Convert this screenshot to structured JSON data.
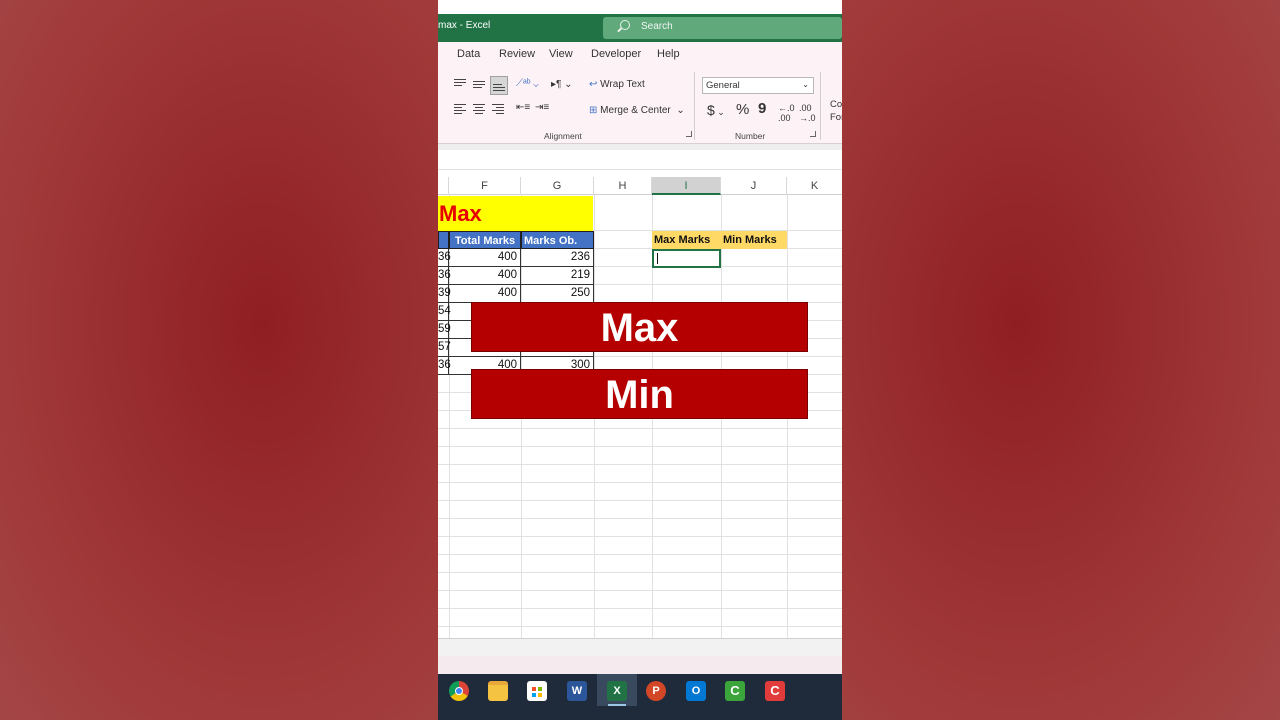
{
  "window": {
    "title": "max  -  Excel",
    "search_placeholder": "Search"
  },
  "tabs": [
    "Data",
    "Review",
    "View",
    "Developer",
    "Help"
  ],
  "ribbon": {
    "wrap_text": "Wrap Text",
    "merge_center": "Merge & Center",
    "number_format": "General",
    "currency": "$",
    "percent": "%",
    "comma": "9",
    "alignment_label": "Alignment",
    "number_label": "Number",
    "cond_fmt_1": "Co",
    "cond_fmt_2": "For"
  },
  "columns": [
    "F",
    "G",
    "H",
    "I",
    "J",
    "K"
  ],
  "sheet": {
    "title": "Max",
    "headers": {
      "total": "Total Marks",
      "obtained": "Marks Ob.",
      "max": "Max Marks",
      "min": "Min Marks"
    },
    "row_prefixes": [
      "36",
      "36",
      "39",
      "54",
      "59",
      "57",
      "36"
    ],
    "total_marks": [
      "400",
      "400",
      "400",
      "",
      "",
      "",
      "400"
    ],
    "marks_obtained": [
      "236",
      "219",
      "250",
      "",
      "",
      "",
      "300"
    ]
  },
  "banners": {
    "max": "Max",
    "min": "Min"
  },
  "taskbar": [
    "chrome-icon",
    "file-explorer-icon",
    "store-icon",
    "word-icon",
    "excel-icon",
    "powerpoint-icon",
    "outlook-icon",
    "camtasia-icon",
    "camtasia-recorder-icon"
  ],
  "colors": {
    "excel_green": "#217346",
    "banner_red": "#b40000",
    "header_blue": "#4472c4",
    "header_gold": "#ffd966",
    "title_yellow": "#ffff00",
    "title_red": "#e60000"
  }
}
